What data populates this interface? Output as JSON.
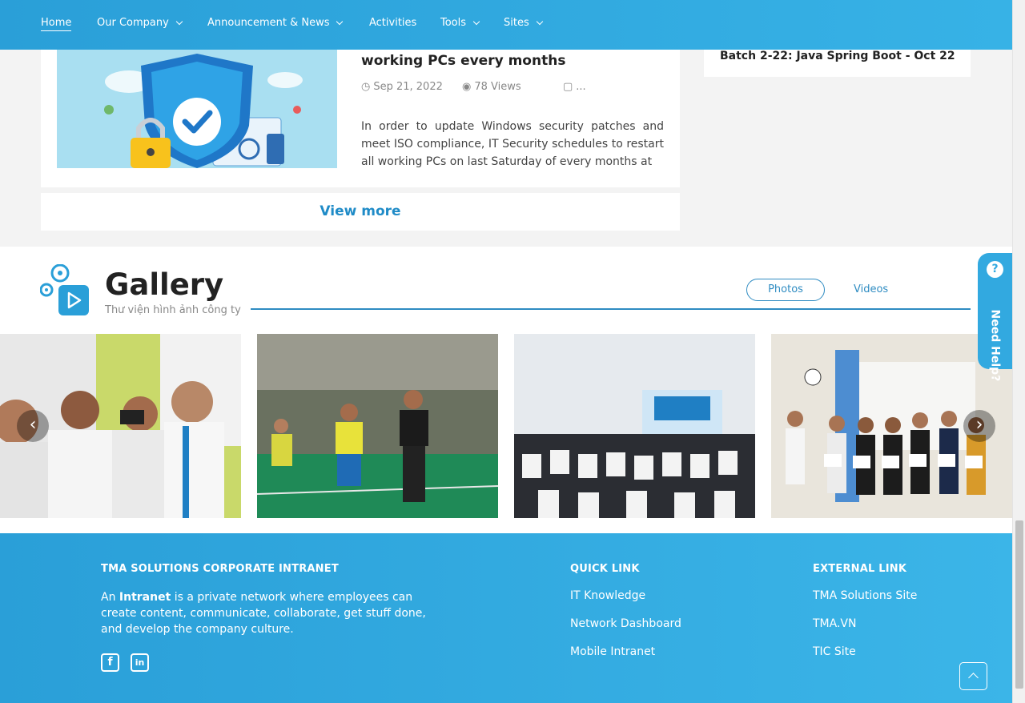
{
  "nav": {
    "items": [
      {
        "label": "Home",
        "dropdown": false,
        "active": true
      },
      {
        "label": "Our Company",
        "dropdown": true
      },
      {
        "label": "Announcement & News",
        "dropdown": true
      },
      {
        "label": "Activities",
        "dropdown": false
      },
      {
        "label": "Tools",
        "dropdown": true
      },
      {
        "label": "Sites",
        "dropdown": true
      }
    ]
  },
  "news": {
    "title": "working PCs every months",
    "date": "Sep 21, 2022",
    "views": "78 Views",
    "comments": "...",
    "body": "In order to update Windows security patches and meet ISO compliance, IT Security schedules to restart all working PCs on last Saturday of every months at",
    "view_more": "View more"
  },
  "sidebar": {
    "latest_title": "Batch 2-22: Java Spring Boot - Oct 22"
  },
  "gallery": {
    "title": "Gallery",
    "subtitle": "Thư viện hình ảnh công ty",
    "tabs": {
      "photos": "Photos",
      "videos": "Videos"
    },
    "prev": "‹",
    "next": "›"
  },
  "need_help": {
    "label": "Need Help?",
    "icon": "?"
  },
  "footer": {
    "about_heading": "TMA SOLUTIONS CORPORATE INTRANET",
    "about_prefix": "An",
    "about_bold": "Intranet",
    "about_suffix": "is a private network where employees can create content, communicate, collaborate, get stuff done, and develop the company culture.",
    "quick_heading": "QUICK LINK",
    "quick_links": [
      "IT Knowledge",
      "Network Dashboard",
      "Mobile Intranet"
    ],
    "external_heading": "EXTERNAL LINK",
    "external_links": [
      "TMA Solutions Site",
      "TMA.VN",
      "TIC Site"
    ],
    "social": {
      "facebook": "f",
      "linkedin": "in"
    }
  },
  "colors": {
    "primary": "#2f8cc2",
    "nav": "#2a9fd8",
    "footer": "#37b2e6"
  }
}
